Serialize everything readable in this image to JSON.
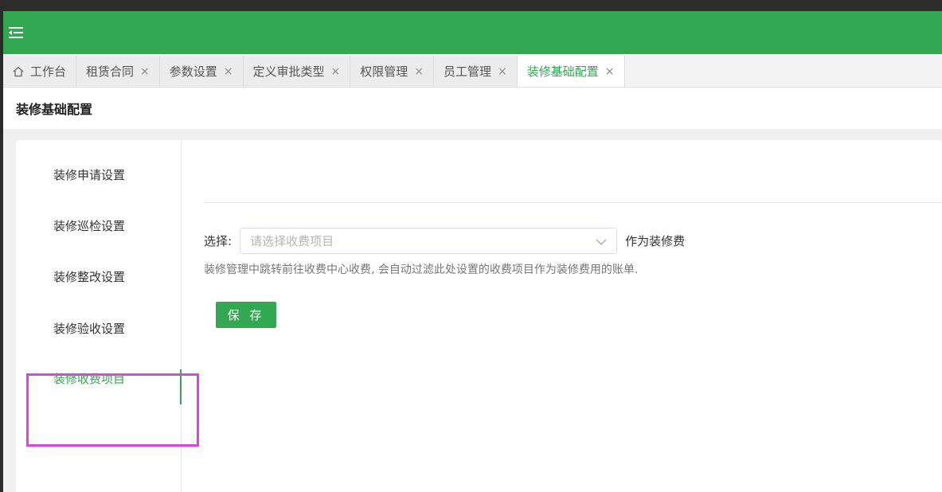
{
  "tabs": [
    {
      "label": "工作台",
      "closable": false,
      "icon": "home-icon"
    },
    {
      "label": "租赁合同",
      "closable": true
    },
    {
      "label": "参数设置",
      "closable": true
    },
    {
      "label": "定义审批类型",
      "closable": true
    },
    {
      "label": "权限管理",
      "closable": true
    },
    {
      "label": "员工管理",
      "closable": true
    },
    {
      "label": "装修基础配置",
      "closable": true,
      "active": true
    }
  ],
  "close_glyph": "×",
  "page": {
    "title": "装修基础配置"
  },
  "side_menu": {
    "items": [
      {
        "label": "装修申请设置"
      },
      {
        "label": "装修巡检设置"
      },
      {
        "label": "装修整改设置"
      },
      {
        "label": "装修验收设置"
      },
      {
        "label": "装修收费项目",
        "active": true
      }
    ]
  },
  "form": {
    "select_label": "选择:",
    "select_placeholder": "请选择收费项目",
    "suffix": "作为装修费",
    "hint": "装修管理中跳转前往收费中心收费, 会自动过滤此处设置的收费项目作为装修费用的账单.",
    "save_label": "保 存"
  },
  "colors": {
    "brand": "#33a852",
    "highlight": "#e040e8"
  }
}
